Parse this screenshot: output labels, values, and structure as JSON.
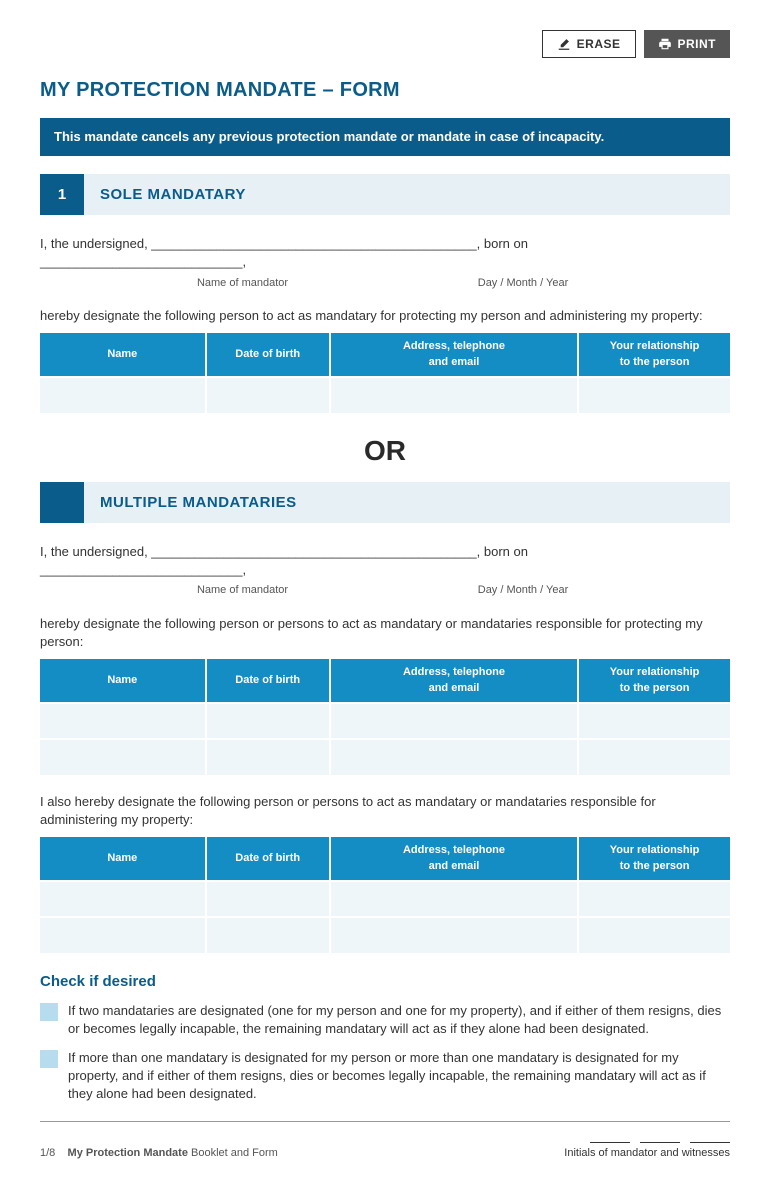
{
  "toolbar": {
    "erase_label": "ERASE",
    "print_label": "PRINT"
  },
  "title": "MY PROTECTION MANDATE – FORM",
  "notice": "This mandate cancels any previous protection mandate or mandate in case of incapacity.",
  "section1": {
    "number": "1",
    "title": "SOLE MANDATARY",
    "fill_line": "I, the undersigned, _____________________________________________, born on ____________________________,",
    "sub_name": "Name of mandator",
    "sub_date": "Day / Month / Year",
    "designate_text": "hereby designate the following person to act as mandatary for protecting my person and administering my property:"
  },
  "or_text": "OR",
  "section2": {
    "title": "MULTIPLE MANDATARIES",
    "fill_line": "I, the undersigned, _____________________________________________, born on ____________________________,",
    "sub_name": "Name of mandator",
    "sub_date": "Day / Month / Year",
    "designate_text1": "hereby designate the following person or persons to act as mandatary or mandataries responsible for protecting my person:",
    "designate_text2": "I also hereby designate the following person or persons to act as mandatary or mandataries responsible for administering my property:"
  },
  "table_headers": {
    "name": "Name",
    "dob": "Date of birth",
    "addr": "Address, telephone\nand email",
    "rel": "Your relationship\nto the person"
  },
  "check": {
    "heading": "Check if desired",
    "item1": "If two mandataries are designated (one for my person and one for my property), and if either of them resigns, dies or becomes legally incapable, the remaining mandatary will act as if they alone had been designated.",
    "item2": "If more than one mandatary is designated for my person or more than one mandatary is designated for my property, and if either of them resigns, dies or becomes legally incapable, the remaining mandatary will act as if they alone had been designated."
  },
  "footer": {
    "page": "1/8",
    "booklet_bold": "My Protection Mandate",
    "booklet_rest": " Booklet and Form",
    "initials": "Initials of mandator and witnesses"
  }
}
